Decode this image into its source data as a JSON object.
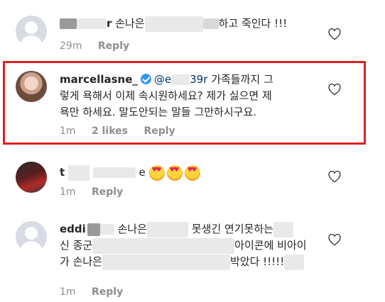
{
  "comments": [
    {
      "username_fragment": "r",
      "text": "손나은",
      "text_after": "하고 죽인다 !!!",
      "time": "29m",
      "reply_label": "Reply"
    },
    {
      "username": "marcellasne_",
      "mention_start": "@e",
      "mention_end": "39r",
      "line1_text": "가족들까지 그",
      "line2_text": "렇게 욕해서 이제 속시원하세요? 제가 싫으면 제",
      "line3_text": "욕만 하세요. 말도안되는 말들 그만하시구요.",
      "time": "1m",
      "likes": "2 likes",
      "reply_label": "Reply"
    },
    {
      "username_fragment": "t",
      "username_tail": "e",
      "time": "1m",
      "reply_label": "Reply"
    },
    {
      "username": "eddi",
      "line1_a": "손나은",
      "line1_b": "못생긴 연기못하는",
      "line2_a": "신 종군",
      "line2_b": "아이콘에 비아이",
      "line3_a": "가 손나은",
      "line3_b": "박았다 !!!!!",
      "time": "1m",
      "reply_label": "Reply"
    }
  ],
  "icons": {
    "heart": "heart-outline-icon",
    "verified": "verified-badge-icon",
    "emoji": "heart-eyes-emoji-icon"
  },
  "colors": {
    "highlight": "#e02020",
    "verified": "#3897f0",
    "mention": "#003569",
    "meta": "#8e8e8e"
  }
}
